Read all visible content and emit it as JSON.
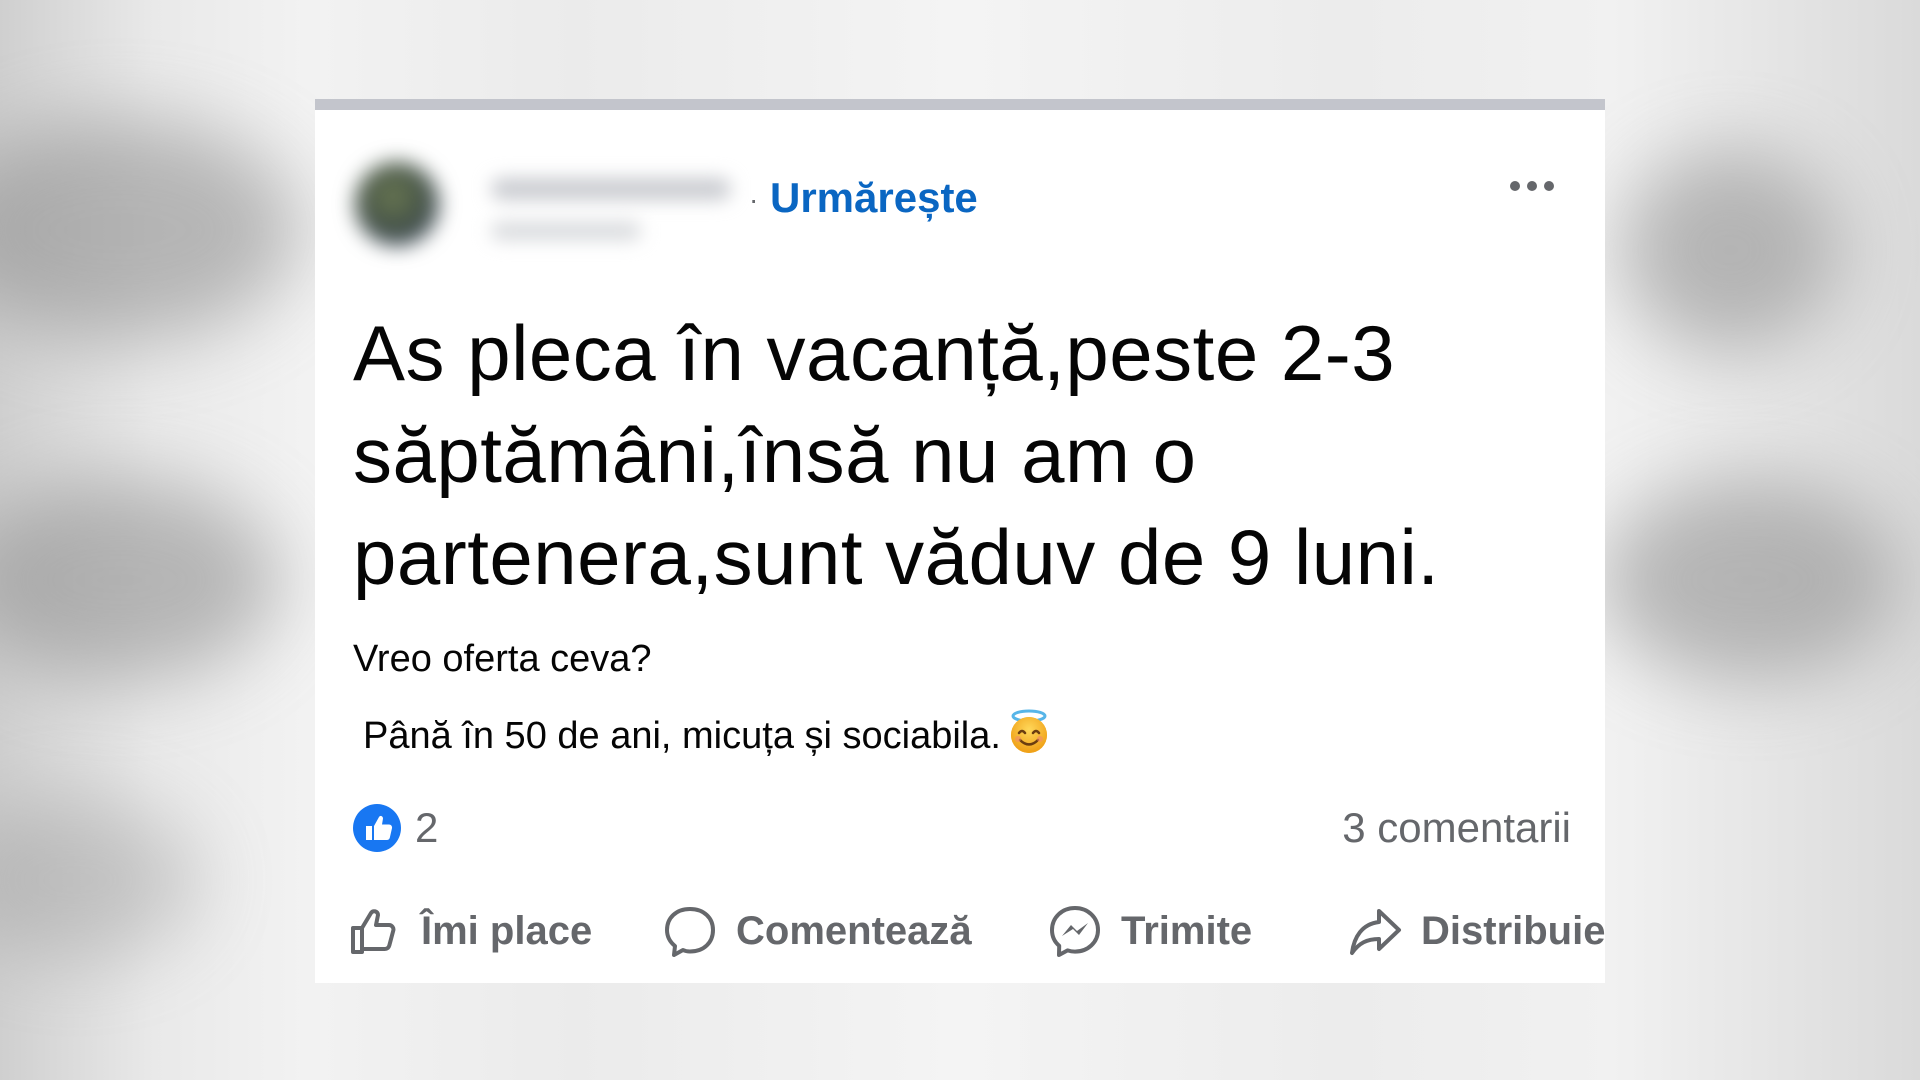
{
  "post": {
    "follow_label": "Urmărește",
    "separator": "·",
    "text_line1": "As pleca în vacanță,peste 2-3",
    "text_line2": "săptămâni,însă nu am o",
    "text_line3": "partenera,sunt văduv de 9 luni.",
    "question": "Vreo oferta ceva?",
    "details": "Până în 50 de ani, micuța și sociabila."
  },
  "stats": {
    "likes": "2",
    "comments": "3 comentarii"
  },
  "actions": {
    "like": "Îmi place",
    "comment": "Comentează",
    "send": "Trimite",
    "share": "Distribuie"
  },
  "colors": {
    "link": "#0a66c2",
    "secondary_text": "#65676b",
    "primary_text": "#050505",
    "like_badge": "#1877f2"
  },
  "icons": [
    "more-options-icon",
    "like-badge-icon",
    "halo-emoji-icon",
    "thumbs-up-icon",
    "comment-icon",
    "messenger-icon",
    "share-icon"
  ]
}
